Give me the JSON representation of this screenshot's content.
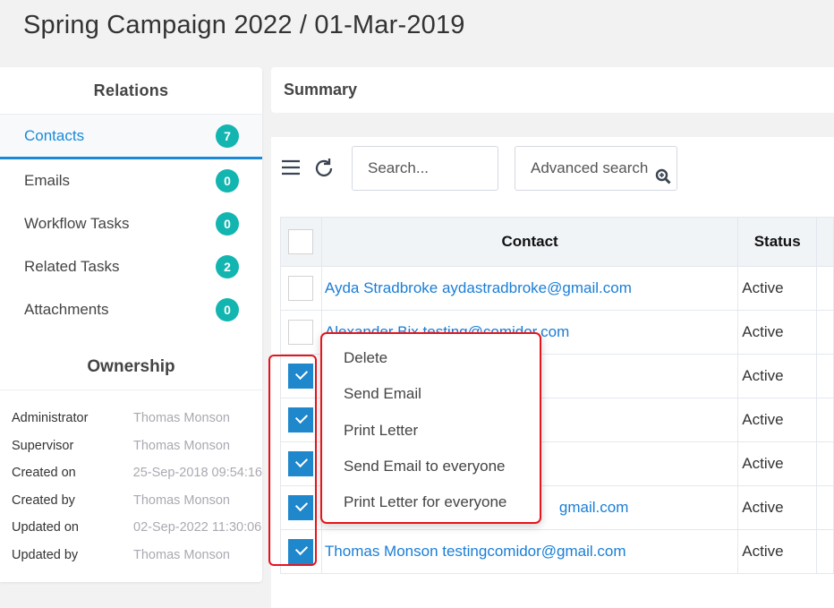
{
  "title": "Spring Campaign 2022 / 01-Mar-2019",
  "relations": {
    "heading": "Relations",
    "items": [
      {
        "label": "Contacts",
        "count": "7",
        "active": true
      },
      {
        "label": "Emails",
        "count": "0"
      },
      {
        "label": "Workflow Tasks",
        "count": "0"
      },
      {
        "label": "Related Tasks",
        "count": "2"
      },
      {
        "label": "Attachments",
        "count": "0"
      }
    ]
  },
  "ownership": {
    "heading": "Ownership",
    "rows": [
      {
        "key": "Administrator",
        "value": "Thomas Monson"
      },
      {
        "key": "Supervisor",
        "value": "Thomas Monson"
      },
      {
        "key": "Created on",
        "value": "25-Sep-2018 09:54:16"
      },
      {
        "key": "Created by",
        "value": "Thomas Monson"
      },
      {
        "key": "Updated on",
        "value": "02-Sep-2022 11:30:06"
      },
      {
        "key": "Updated by",
        "value": "Thomas Monson"
      }
    ]
  },
  "summary": {
    "title": "Summary"
  },
  "toolbar": {
    "search_placeholder": "Search...",
    "advanced_label": "Advanced search"
  },
  "table": {
    "headers": {
      "contact": "Contact",
      "status": "Status"
    },
    "rows": [
      {
        "contact": "Ayda Stradbroke aydastradbroke@gmail.com",
        "status": "Active",
        "checked": false
      },
      {
        "contact": "Alexander Bix testing@comidor.com",
        "status": "Active",
        "checked": false
      },
      {
        "contact": "",
        "status": "Active",
        "checked": true
      },
      {
        "contact": "",
        "status": "Active",
        "checked": true
      },
      {
        "contact": "",
        "status": "Active",
        "checked": true
      },
      {
        "contact": "gmail.com",
        "status": "Active",
        "checked": true
      },
      {
        "contact": "Thomas Monson testingcomidor@gmail.com",
        "status": "Active",
        "checked": true
      }
    ]
  },
  "context_menu": {
    "items": [
      "Delete",
      "Send Email",
      "Print Letter",
      "Send Email to everyone",
      "Print Letter for everyone"
    ]
  },
  "colors": {
    "accent": "#1a8ad8",
    "badge": "#12b5b0",
    "checkbox": "#1f87cc",
    "highlight": "#e8141b"
  }
}
